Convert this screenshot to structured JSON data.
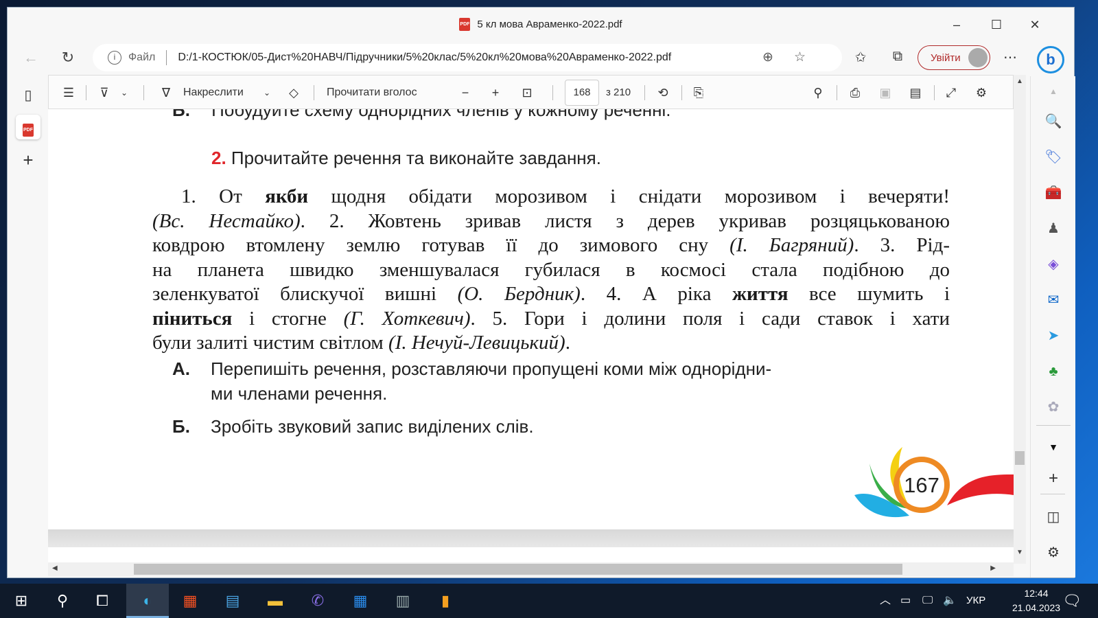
{
  "window": {
    "title": "5 кл мова Авраменко-2022.pdf"
  },
  "address": {
    "file_label": "Файл",
    "url": "D:/1-КОСТЮК/05-Дист%20НАВЧ/Підручники/5%20клас/5%20кл%20мова%20Авраменко-2022.pdf",
    "signin": "Увійти"
  },
  "pdf_toolbar": {
    "draw": "Накреслити",
    "read_aloud": "Прочитати вголос",
    "page": "168",
    "of_pages": "з 210"
  },
  "document": {
    "prev_item": {
      "label": "Б.",
      "text": "Побудуйте схему однорідних членів у кожному реченні."
    },
    "task": {
      "num": "2.",
      "text": "Прочитайте речення та виконайте завдання."
    },
    "lines": [
      [
        {
          "t": "1. От "
        },
        {
          "t": "якби",
          "s": "b"
        },
        {
          "t": " щодня обідати морозивом і снідати морозивом і вечеряти!"
        }
      ],
      [
        {
          "t": "(Вс. Нестайко)",
          "s": "i"
        },
        {
          "t": ". 2. Жовтень зривав листя з дерев укривав розцяцькованою"
        }
      ],
      [
        {
          "t": "ковдрою втомлену землю готував її до зимового сну "
        },
        {
          "t": "(І. Багряний)",
          "s": "i"
        },
        {
          "t": ". 3. Рід-"
        }
      ],
      [
        {
          "t": "на планета швидко зменшувалася губилася в космосі стала подібною до"
        }
      ],
      [
        {
          "t": "зеленкуватої блискучої вишні "
        },
        {
          "t": "(О. Бердник)",
          "s": "i"
        },
        {
          "t": ". 4. А ріка "
        },
        {
          "t": "життя",
          "s": "b"
        },
        {
          "t": " все шумить і"
        }
      ],
      [
        {
          "t": "піниться",
          "s": "b"
        },
        {
          "t": " і стогне "
        },
        {
          "t": "(Г. Хоткевич)",
          "s": "i"
        },
        {
          "t": ". 5. Гори і долини поля і сади ставок і хати"
        }
      ],
      [
        {
          "t": "були залиті чистим світлом "
        },
        {
          "t": "(І. Нечуй-Левицький)",
          "s": "i"
        },
        {
          "t": "."
        }
      ]
    ],
    "items": [
      {
        "label": "А.",
        "text1": "Перепишіть речення, розставляючи пропущені коми між однорідни-",
        "text2": "ми членами речення."
      },
      {
        "label": "Б.",
        "text1": "Зробіть звуковий запис виділених слів."
      }
    ],
    "page_number": "167",
    "colors": {
      "task_num": "#e0262b"
    }
  },
  "taskbar": {
    "lang": "УКР",
    "time": "12:44",
    "date": "21.04.2023"
  }
}
